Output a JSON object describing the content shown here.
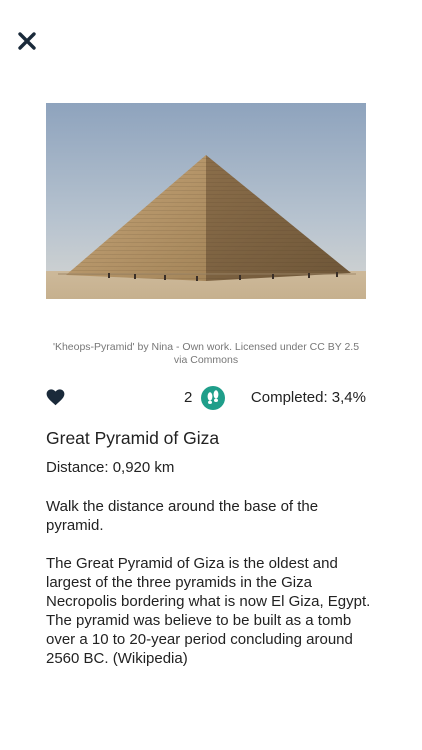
{
  "header": {
    "close_icon": "close-icon"
  },
  "image": {
    "subject": "pyramid-photo",
    "credit": "'Kheops-Pyramid' by Nina - Own work. Licensed under CC BY 2.5 via Commons"
  },
  "stats": {
    "favorite_icon": "heart-icon",
    "footsteps_count": "2",
    "footsteps_icon": "footprints-icon",
    "completed": "Completed: 3,4%"
  },
  "challenge": {
    "title": "Great Pyramid of Giza",
    "distance": "Distance: 0,920 km",
    "instructions": "Walk the distance around the base of the pyramid.",
    "description": "The Great Pyramid of Giza is the oldest and largest of the three pyramids in the Giza Necropolis bordering what is now El Giza, Egypt. The pyramid was believe to be built as a tomb over a 10 to 20-year period concluding around 2560 BC. (Wikipedia)"
  },
  "colors": {
    "accent": "#1f9e8a",
    "text": "#222222",
    "muted": "#777777"
  }
}
